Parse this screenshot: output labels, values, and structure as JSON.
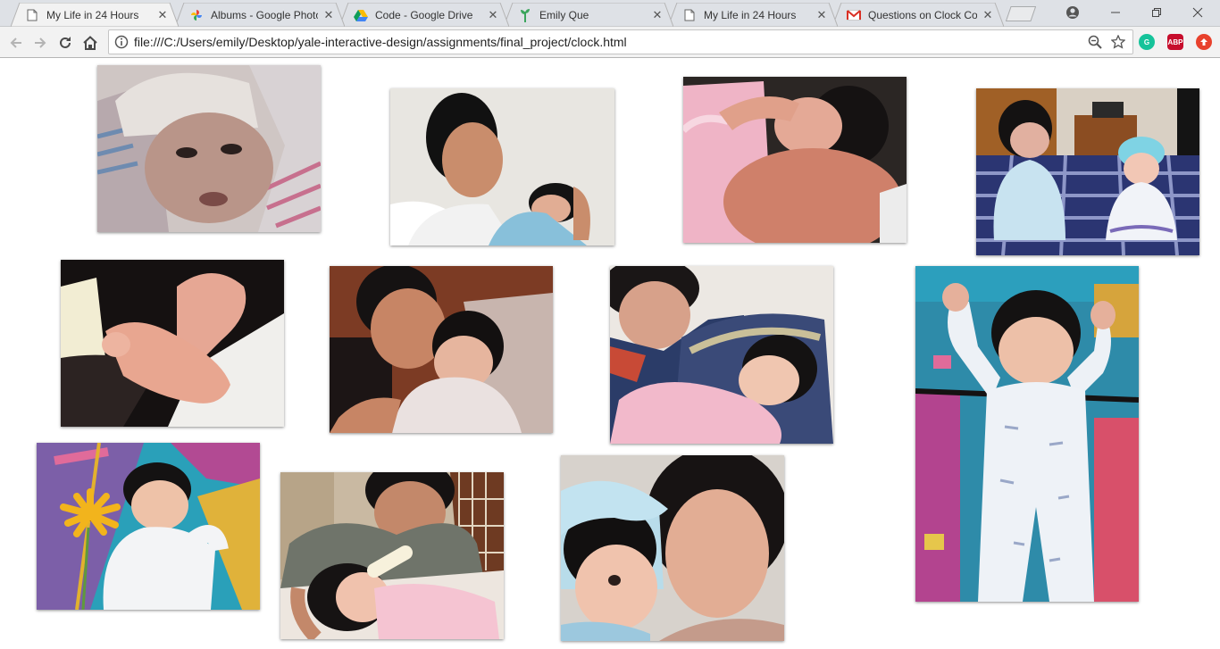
{
  "browser": {
    "tabs": [
      {
        "title": "My Life in 24 Hours",
        "favicon": "page-icon",
        "active": true
      },
      {
        "title": "Albums - Google Photos",
        "favicon": "google-photos-icon",
        "active": false
      },
      {
        "title": "Code - Google Drive",
        "favicon": "google-drive-icon",
        "active": false
      },
      {
        "title": "Emily Que",
        "favicon": "plant-icon",
        "active": false
      },
      {
        "title": "My Life in 24 Hours",
        "favicon": "page-icon",
        "active": false
      },
      {
        "title": "Questions on Clock Concept",
        "favicon": "gmail-icon",
        "active": false
      }
    ],
    "address_bar": {
      "url": "file:///C:/Users/emily/Desktop/yale-interactive-design/assignments/final_project/clock.html"
    },
    "extensions": [
      {
        "name": "grammarly-icon",
        "label": "G",
        "color": "#15c39a"
      },
      {
        "name": "adblock-plus-icon",
        "label": "ABP",
        "color": "#c70d2c"
      },
      {
        "name": "extension-up-icon",
        "label": "",
        "color": "#e8412c"
      }
    ]
  },
  "gallery": {
    "photos": [
      {
        "subject": "newborn-in-hospital-blanket",
        "palette": [
          "#d9cfc9",
          "#a08a80",
          "#6a8aa8"
        ]
      },
      {
        "subject": "father-holding-baby",
        "palette": [
          "#e7e4de",
          "#1c1c1c",
          "#7fb6d6"
        ]
      },
      {
        "subject": "baby-sleeping-arms-up",
        "palette": [
          "#2a2522",
          "#d98e74",
          "#f0b9c9"
        ]
      },
      {
        "subject": "baby-with-doll-on-bed",
        "palette": [
          "#2a356e",
          "#c8e2ef",
          "#9a5a2a"
        ]
      },
      {
        "subject": "baby-feet",
        "palette": [
          "#1a1514",
          "#e3a592",
          "#f2efe8"
        ]
      },
      {
        "subject": "father-cuddling-baby",
        "palette": [
          "#7a3a26",
          "#e8dcd6",
          "#1d1a1a"
        ]
      },
      {
        "subject": "mother-with-baby-in-rocker",
        "palette": [
          "#efe9e2",
          "#f1b8c8",
          "#2c3a62"
        ]
      },
      {
        "subject": "baby-arms-raised-on-rug",
        "palette": [
          "#2e8aa8",
          "#eef2f6",
          "#b0428f"
        ]
      },
      {
        "subject": "baby-with-yellow-flower",
        "palette": [
          "#2a9fb8",
          "#f2f2f2",
          "#f0b820"
        ]
      },
      {
        "subject": "father-feeding-baby",
        "palette": [
          "#6e6e64",
          "#f4c5d2",
          "#c08660"
        ]
      },
      {
        "subject": "mother-and-baby-portrait",
        "palette": [
          "#b9dcea",
          "#e6b49a",
          "#151212"
        ]
      }
    ]
  }
}
